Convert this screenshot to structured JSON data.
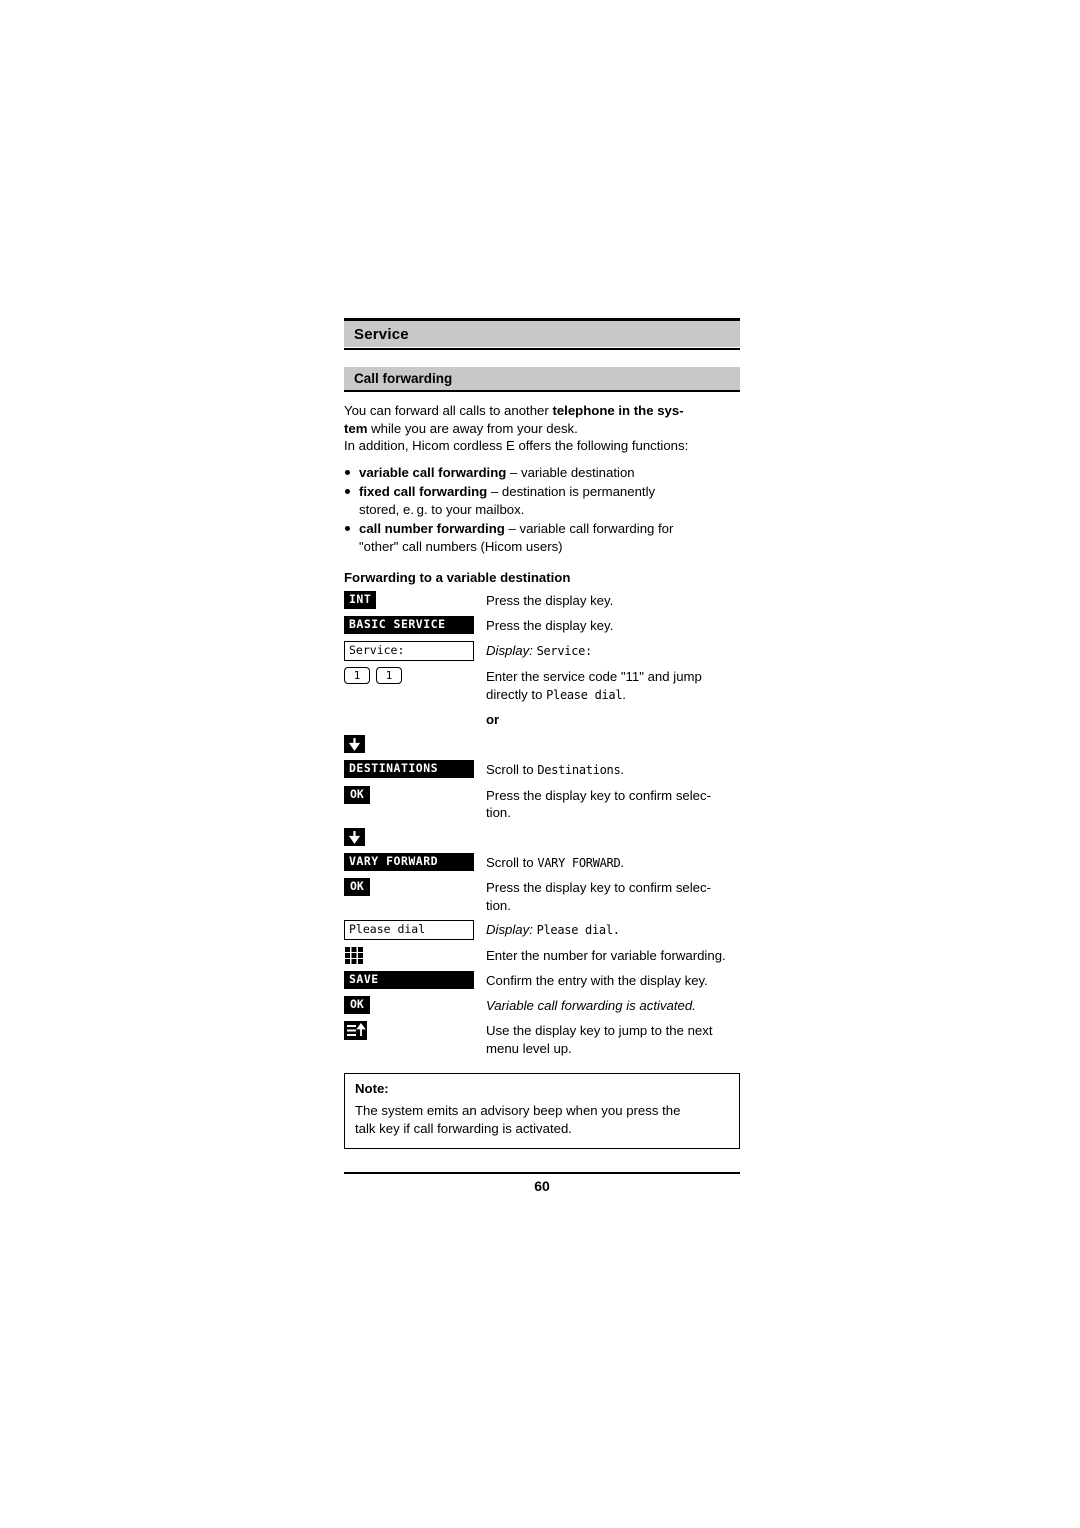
{
  "header": {
    "title": "Service"
  },
  "section": {
    "title": "Call forwarding"
  },
  "intro": {
    "p1_a": "You can forward all calls to another ",
    "p1_b": "telephone in the sys-",
    "p1_c": "tem",
    "p1_d": " while you are away from your desk.",
    "p2": "In addition, Hicom cordless E offers the following functions:"
  },
  "bullets": [
    {
      "bold": "variable call forwarding",
      "rest": " – variable destination"
    },
    {
      "bold": "fixed call forwarding",
      "rest": " – destination is permanently",
      "cont": "stored, e. g. to your mailbox."
    },
    {
      "bold": "call number forwarding",
      "rest": " – variable call forwarding for",
      "cont": "\"other\" call numbers (Hicom users)"
    }
  ],
  "subhead": "Forwarding to a variable destination",
  "steps": [
    {
      "key": "INT",
      "keytype": "black",
      "text": "Press the display key."
    },
    {
      "key": "BASIC SERVICE",
      "keytype": "black-wide",
      "text": "Press the display key."
    },
    {
      "key": "Service:",
      "keytype": "display",
      "text_italic": "Display:",
      "text_mono": "Service:"
    },
    {
      "key1": "1",
      "key2": "1",
      "keytype": "numpair",
      "text": "Enter the service code \"11\" and jump",
      "cont_pre": "directly to ",
      "cont_mono": "Please dial",
      "cont_post": "."
    },
    {
      "keytype": "none",
      "text_bold": "or"
    },
    {
      "keytype": "arrow-down",
      "text": ""
    },
    {
      "key": "DESTINATIONS",
      "keytype": "black-wide",
      "text_pre": "Scroll to ",
      "text_mono": "Destinations",
      "text_post": "."
    },
    {
      "key": "OK",
      "keytype": "ok",
      "text": "Press the display key to confirm selec-",
      "cont": "tion."
    },
    {
      "keytype": "arrow-down",
      "text": ""
    },
    {
      "key": "VARY FORWARD",
      "keytype": "black-wide",
      "text_pre": "Scroll to ",
      "text_mono": "VARY FORWARD",
      "text_post": "."
    },
    {
      "key": "OK",
      "keytype": "ok",
      "text": "Press the display key to confirm selec-",
      "cont": "tion."
    },
    {
      "key": "Please dial",
      "keytype": "display",
      "text_italic": "Display:",
      "text_mono": "Please dial."
    },
    {
      "keytype": "keypad",
      "text": "Enter the number for variable forwarding."
    },
    {
      "key": "SAVE",
      "keytype": "black-wide",
      "text": "Confirm the entry with the display key."
    },
    {
      "key": "OK",
      "keytype": "ok",
      "text_italic_full": "Variable call forwarding is activated."
    },
    {
      "keytype": "menu-up",
      "text": "Use the display key to jump to the next",
      "cont": "menu level up."
    }
  ],
  "note": {
    "title": "Note:",
    "line1": "The system emits an advisory beep when you press the",
    "line2": "talk key if call forwarding is activated."
  },
  "footer": {
    "page_number": "60"
  }
}
